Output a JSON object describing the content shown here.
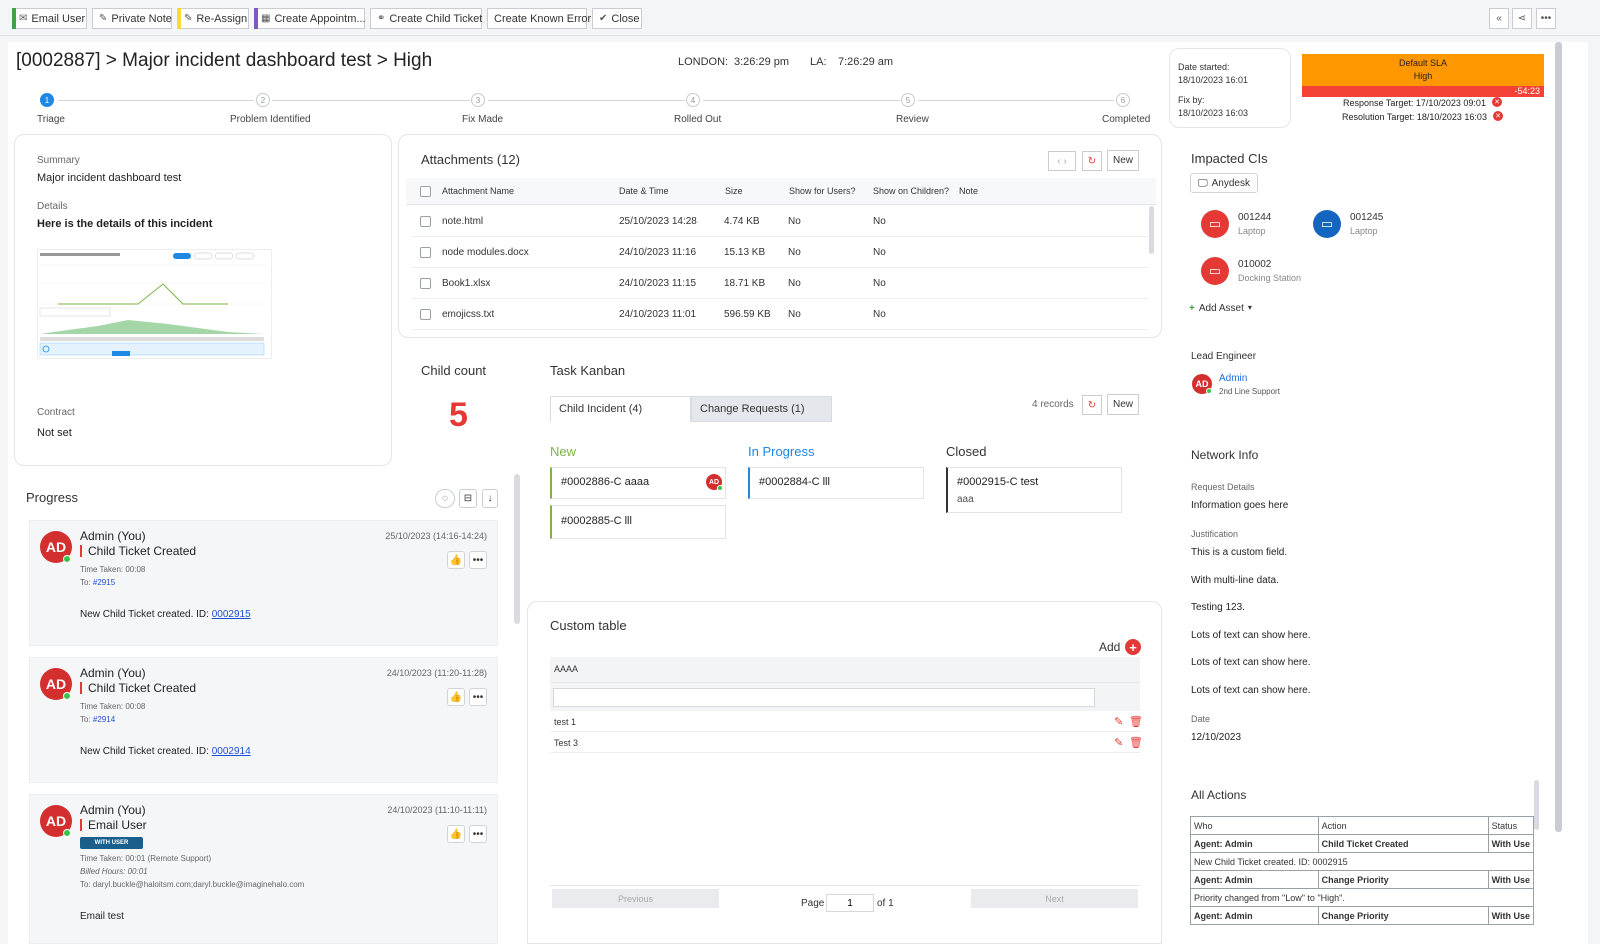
{
  "toolbar": {
    "buttons": [
      {
        "label": "Email User",
        "icon": "envelope-icon",
        "bar_color": "#43a047"
      },
      {
        "label": "Private Note",
        "icon": "note-icon",
        "bar_color": ""
      },
      {
        "label": "Re-Assign",
        "icon": "reassign-icon",
        "bar_color": "#fdd835"
      },
      {
        "label": "Create Appointm...",
        "icon": "calendar-icon",
        "bar_color": "#7e57c2"
      },
      {
        "label": "Create Child Ticket",
        "icon": "link-icon",
        "bar_color": ""
      },
      {
        "label": "Create Known Error",
        "icon": "",
        "bar_color": ""
      },
      {
        "label": "Close",
        "icon": "check-icon",
        "bar_color": ""
      }
    ],
    "right_icons": [
      "collapse-icon",
      "share-icon",
      "more-icon"
    ]
  },
  "header": {
    "title": "[0002887] > Major incident dashboard test > High",
    "london_label": "LONDON:",
    "london_time": "3:26:29 pm",
    "la_label": "LA:",
    "la_time": "7:26:29 am"
  },
  "dates": {
    "started_label": "Date started:",
    "started_value": "18/10/2023 16:01",
    "fixby_label": "Fix by:",
    "fixby_value": "18/10/2023 16:03"
  },
  "sla": {
    "title": "Default SLA",
    "priority": "High",
    "overdue": "-54:23",
    "response_target": "Response Target: 17/10/2023 09:01",
    "resolution_target": "Resolution Target: 18/10/2023 16:03",
    "color": "#ff9800",
    "overdue_color": "#f44336"
  },
  "steps": [
    {
      "num": "1",
      "label": "Triage"
    },
    {
      "num": "2",
      "label": "Problem Identified"
    },
    {
      "num": "3",
      "label": "Fix Made"
    },
    {
      "num": "4",
      "label": "Rolled Out"
    },
    {
      "num": "5",
      "label": "Review"
    },
    {
      "num": "6",
      "label": "Completed"
    }
  ],
  "summary": {
    "summary_label": "Summary",
    "summary_value": "Major incident dashboard test",
    "details_label": "Details",
    "details_value": "Here is the details of this incident",
    "contract_label": "Contract",
    "contract_value": "Not set"
  },
  "attachments": {
    "title": "Attachments (12)",
    "new_label": "New",
    "columns": [
      "Attachment Name",
      "Date & Time",
      "Size",
      "Show for Users?",
      "Show on Children?",
      "Note"
    ],
    "rows": [
      {
        "name": "note.html",
        "date": "25/10/2023 14:28",
        "size": "4.74 KB",
        "users": "No",
        "children": "No"
      },
      {
        "name": "node modules.docx",
        "date": "24/10/2023 11:16",
        "size": "15.13 KB",
        "users": "No",
        "children": "No"
      },
      {
        "name": "Book1.xlsx",
        "date": "24/10/2023 11:15",
        "size": "18.71 KB",
        "users": "No",
        "children": "No"
      },
      {
        "name": "emojicss.txt",
        "date": "24/10/2023 11:01",
        "size": "596.59 KB",
        "users": "No",
        "children": "No"
      }
    ]
  },
  "child_count": {
    "label": "Child count",
    "value": "5"
  },
  "kanban": {
    "title": "Task Kanban",
    "tabs": [
      "Child Incident (4)",
      "Change Requests (1)"
    ],
    "records": "4 records",
    "new_label": "New",
    "columns": [
      {
        "title": "New",
        "color": "#7cb342",
        "cards": [
          {
            "id": "#0002886-C aaaa",
            "sub": "",
            "avatar": "AD"
          },
          {
            "id": "#0002885-C lll",
            "sub": "",
            "avatar": ""
          }
        ]
      },
      {
        "title": "In Progress",
        "color": "#1e88e5",
        "cards": [
          {
            "id": "#0002884-C lll",
            "sub": "",
            "avatar": ""
          }
        ]
      },
      {
        "title": "Closed",
        "color": "#333333",
        "cards": [
          {
            "id": "#0002915-C test",
            "sub": "aaa",
            "avatar": ""
          }
        ]
      }
    ]
  },
  "progress": {
    "title": "Progress",
    "entries": [
      {
        "avatar": "AD",
        "name": "Admin (You)",
        "action": "Child Ticket Created",
        "time": "25/10/2023 (14:16-14:24)",
        "taken": "Time Taken: 00:08",
        "to_label": "To:",
        "to": "#2915",
        "body": "New Child Ticket created. ID:",
        "body_link": "0002915"
      },
      {
        "avatar": "AD",
        "name": "Admin (You)",
        "action": "Child Ticket Created",
        "time": "24/10/2023 (11:20-11:28)",
        "taken": "Time Taken: 00:08",
        "to_label": "To:",
        "to": "#2914",
        "body": "New Child Ticket created. ID:",
        "body_link": "0002914"
      },
      {
        "avatar": "AD",
        "name": "Admin (You)",
        "action": "Email User",
        "time": "24/10/2023 (11:10-11:11)",
        "badge": "WITH USER",
        "taken": "Time Taken: 00:01 (Remote Support)",
        "billed": "Billed Hours: 00:01",
        "to_label": "To:",
        "to": "daryl.buckle@haloitsm.com;daryl.buckle@imaginehalo.com",
        "body": "Email test"
      }
    ]
  },
  "custom_table": {
    "title": "Custom table",
    "add_label": "Add",
    "column": "AAAA",
    "rows": [
      "test 1",
      "Test 3"
    ],
    "prev_label": "Previous",
    "page_label": "Page",
    "page_value": "1",
    "of_label": "of 1",
    "next_label": "Next"
  },
  "impacted": {
    "title": "Impacted CIs",
    "tag": "Anydesk",
    "items": [
      {
        "id": "001244",
        "type": "Laptop",
        "color": "#e53935"
      },
      {
        "id": "001245",
        "type": "Laptop",
        "color": "#1565c0"
      },
      {
        "id": "010002",
        "type": "Docking Station",
        "color": "#e53935"
      }
    ],
    "add_asset": "Add Asset"
  },
  "lead": {
    "title": "Lead Engineer",
    "avatar": "AD",
    "name": "Admin",
    "role": "2nd Line Support"
  },
  "network": {
    "title": "Network Info",
    "request_label": "Request Details",
    "request_value": "Information goes here",
    "justification_label": "Justification",
    "justification_lines": [
      "This is a custom field.",
      "With multi-line data.",
      "Testing 123.",
      "Lots of text can show here.",
      "Lots of text can show here.",
      "Lots of text can show here."
    ],
    "date_label": "Date",
    "date_value": "12/10/2023"
  },
  "all_actions": {
    "title": "All Actions",
    "headers": [
      "Who",
      "Action",
      "Status"
    ],
    "rows": [
      {
        "who": "Agent: Admin",
        "action": "Child Ticket Created",
        "status": "With Use",
        "note": "New Child Ticket created. ID: 0002915"
      },
      {
        "who": "Agent: Admin",
        "action": "Change Priority",
        "status": "With Use",
        "note": "Priority changed from \"Low\" to \"High\"."
      },
      {
        "who": "Agent: Admin",
        "action": "Change Priority",
        "status": "With Use",
        "note": ""
      }
    ]
  }
}
